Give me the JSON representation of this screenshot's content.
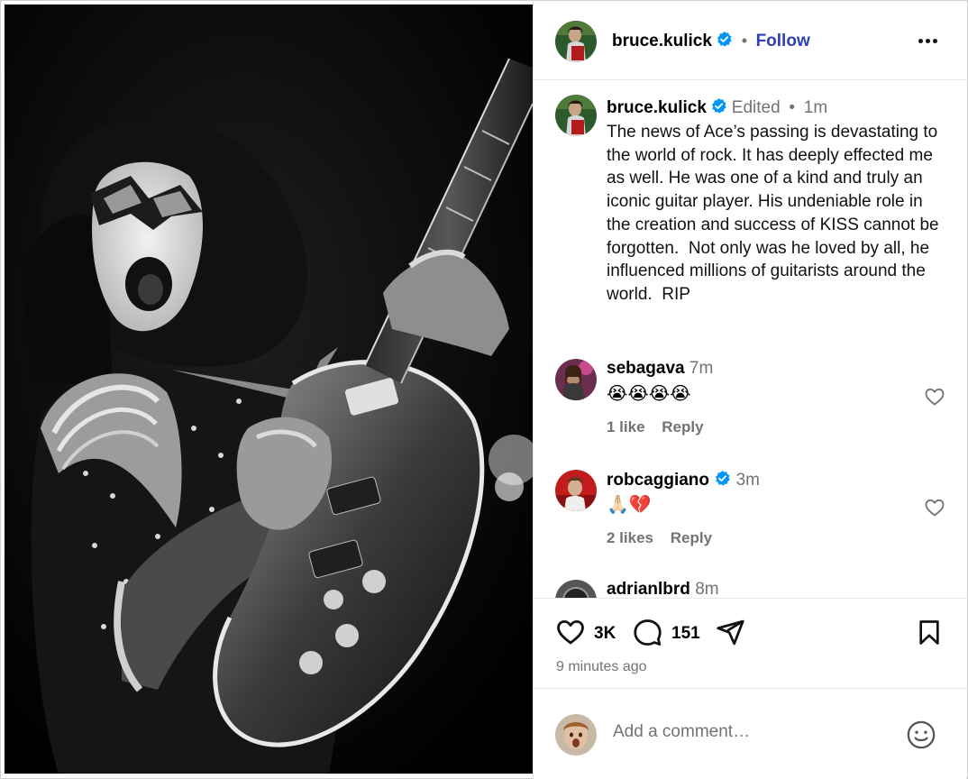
{
  "post": {
    "author": "bruce.kulick",
    "follow_label": "Follow",
    "caption_author": "bruce.kulick",
    "edited_label": "Edited",
    "caption_age": "1m",
    "caption": "The news of Ace’s passing is devastating to the world of rock. It has deeply effected me as well. He was one of a kind and truly an iconic guitar player. His undeniable role in the creation and success of KISS cannot be forgotten.  Not only was he loved by all, he influenced millions of guitarists around the world.  RIP"
  },
  "comments": [
    {
      "user": "sebagava",
      "time": "7m",
      "text": "😭😭😭😭",
      "likes": "1 like",
      "reply": "Reply",
      "verified": false
    },
    {
      "user": "robcaggiano",
      "time": "3m",
      "text": "🙏🏻💔",
      "likes": "2 likes",
      "reply": "Reply",
      "verified": true
    },
    {
      "user": "adrianlbrd",
      "time": "8m"
    }
  ],
  "actions": {
    "like_count": "3K",
    "comment_count": "151",
    "time_ago": "9 minutes ago"
  },
  "add_comment": {
    "placeholder": "Add a comment…"
  },
  "icons": {
    "verified": "verified-badge-icon",
    "more": "more-options-icon",
    "like": "heart-icon",
    "comment": "comment-bubble-icon",
    "share": "paper-plane-icon",
    "save": "bookmark-icon",
    "emoji": "smiley-icon"
  },
  "colors": {
    "follow": "#2f3fb5",
    "verified": "#0095f6",
    "muted": "#737373"
  }
}
